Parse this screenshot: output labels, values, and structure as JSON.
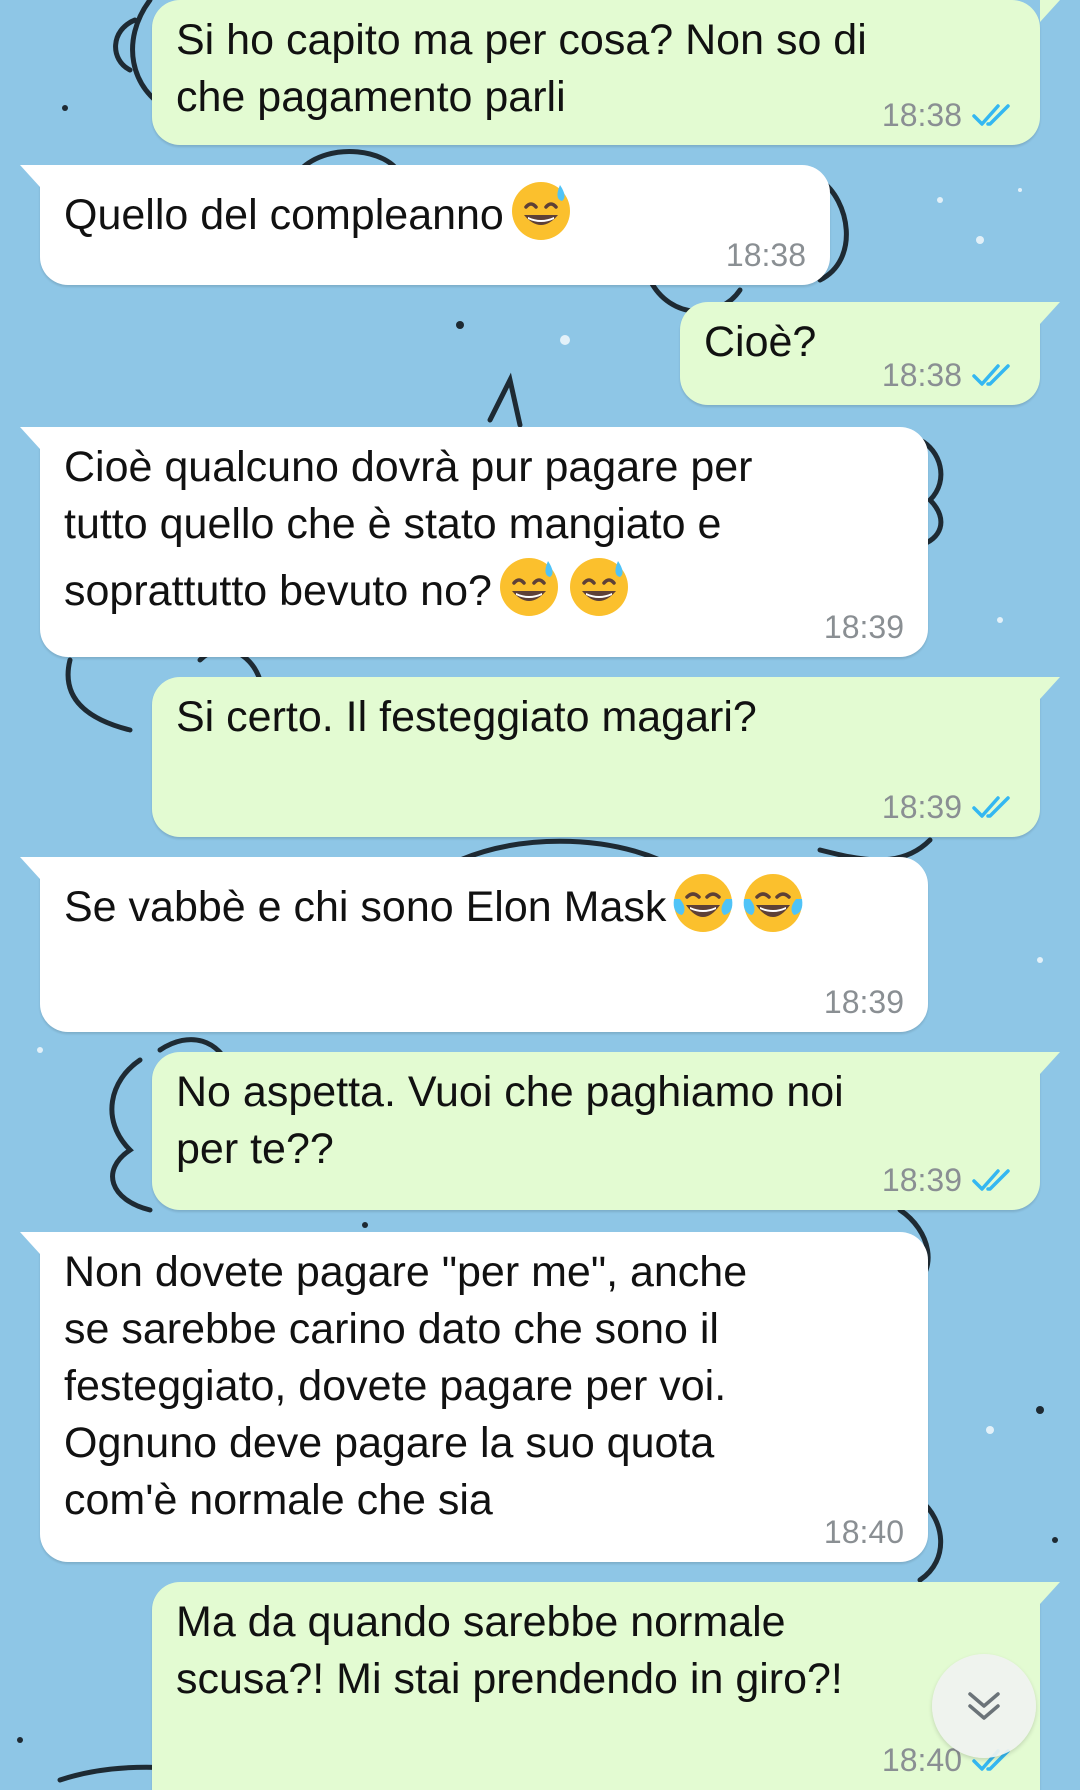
{
  "messages": [
    {
      "dir": "out",
      "text": "Si ho capito ma per cosa? Non so di\nche pagamento parli",
      "time": "18:38",
      "emoji": []
    },
    {
      "dir": "in",
      "text": "Quello del compleanno",
      "time": "18:38",
      "emoji": [
        "sweat-smile"
      ]
    },
    {
      "dir": "out",
      "text": "Cioè?",
      "time": "18:38",
      "emoji": []
    },
    {
      "dir": "in",
      "text": "Cioè qualcuno dovrà pur pagare per\ntutto quello che è stato mangiato e\nsoprattutto bevuto no?",
      "time": "18:39",
      "emoji": [
        "sweat-smile",
        "sweat-smile"
      ]
    },
    {
      "dir": "out",
      "text": "Si certo. Il festeggiato magari?",
      "time": "18:39",
      "emoji": []
    },
    {
      "dir": "in",
      "text": "Se vabbè e chi sono Elon Mask",
      "time": "18:39",
      "emoji": [
        "tears-of-joy",
        "tears-of-joy"
      ]
    },
    {
      "dir": "out",
      "text": "No aspetta. Vuoi che paghiamo noi\nper te??",
      "time": "18:39",
      "emoji": []
    },
    {
      "dir": "in",
      "text": "Non dovete pagare \"per me\", anche\nse sarebbe carino dato che sono il\nfesteggiato, dovete pagare per voi.\nOgnuno deve pagare la suo quota\ncom'è normale che sia",
      "time": "18:40",
      "emoji": []
    },
    {
      "dir": "out",
      "text": "Ma da quando sarebbe normale\nscusa?! Mi stai prendendo in giro?!",
      "time": "18:40",
      "emoji": []
    }
  ],
  "colors": {
    "wallpaper": "#8ec6e6",
    "incoming_bubble": "#ffffff",
    "outgoing_bubble": "#e3fbd2",
    "read_ticks": "#34b7f1",
    "timestamp": "#8a8f93"
  },
  "icons": {
    "read_receipt": "double-check-icon",
    "scroll_down": "chevron-double-down-icon"
  }
}
